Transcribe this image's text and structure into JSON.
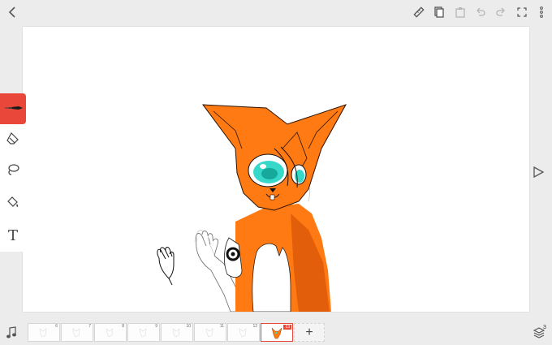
{
  "topbar": {
    "back_icon": "back-chevron-icon",
    "right_icons": [
      "ruler-icon",
      "copy-icon",
      "paste-icon",
      "undo-icon",
      "redo-icon",
      "fullscreen-icon",
      "more-icon"
    ]
  },
  "tools": [
    {
      "name": "pen",
      "icon": "pen-icon",
      "active": true
    },
    {
      "name": "eraser",
      "icon": "eraser-icon",
      "active": false
    },
    {
      "name": "lasso",
      "icon": "lasso-icon",
      "active": false
    },
    {
      "name": "fill",
      "icon": "paint-bucket-icon",
      "active": false
    },
    {
      "name": "text",
      "icon": "text-icon",
      "label": "T",
      "active": false
    }
  ],
  "timeline": {
    "frames": [
      {
        "num": "6"
      },
      {
        "num": "7"
      },
      {
        "num": "8"
      },
      {
        "num": "9"
      },
      {
        "num": "10"
      },
      {
        "num": "11"
      },
      {
        "num": "12"
      },
      {
        "num": "13",
        "current": true
      }
    ],
    "add_label": "+",
    "layers_count": "3"
  },
  "colors": {
    "accent": "#e8473a",
    "fur_orange": "#ff7a12",
    "fur_dark": "#e25e0b",
    "eye_teal": "#35d8c9"
  }
}
